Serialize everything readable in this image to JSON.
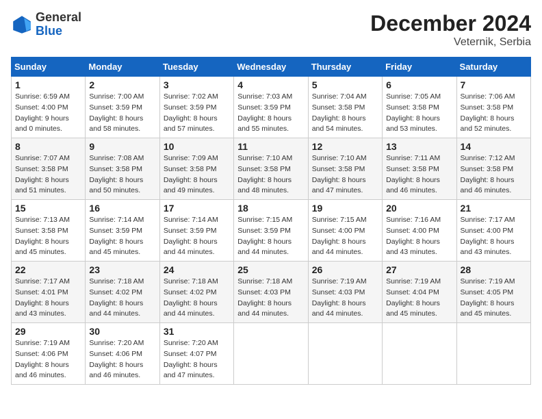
{
  "header": {
    "logo_general": "General",
    "logo_blue": "Blue",
    "month_title": "December 2024",
    "location": "Veternik, Serbia"
  },
  "weekdays": [
    "Sunday",
    "Monday",
    "Tuesday",
    "Wednesday",
    "Thursday",
    "Friday",
    "Saturday"
  ],
  "weeks": [
    [
      {
        "day": "1",
        "sunrise": "6:59 AM",
        "sunset": "4:00 PM",
        "daylight": "9 hours and 0 minutes."
      },
      {
        "day": "2",
        "sunrise": "7:00 AM",
        "sunset": "3:59 PM",
        "daylight": "8 hours and 58 minutes."
      },
      {
        "day": "3",
        "sunrise": "7:02 AM",
        "sunset": "3:59 PM",
        "daylight": "8 hours and 57 minutes."
      },
      {
        "day": "4",
        "sunrise": "7:03 AM",
        "sunset": "3:59 PM",
        "daylight": "8 hours and 55 minutes."
      },
      {
        "day": "5",
        "sunrise": "7:04 AM",
        "sunset": "3:58 PM",
        "daylight": "8 hours and 54 minutes."
      },
      {
        "day": "6",
        "sunrise": "7:05 AM",
        "sunset": "3:58 PM",
        "daylight": "8 hours and 53 minutes."
      },
      {
        "day": "7",
        "sunrise": "7:06 AM",
        "sunset": "3:58 PM",
        "daylight": "8 hours and 52 minutes."
      }
    ],
    [
      {
        "day": "8",
        "sunrise": "7:07 AM",
        "sunset": "3:58 PM",
        "daylight": "8 hours and 51 minutes."
      },
      {
        "day": "9",
        "sunrise": "7:08 AM",
        "sunset": "3:58 PM",
        "daylight": "8 hours and 50 minutes."
      },
      {
        "day": "10",
        "sunrise": "7:09 AM",
        "sunset": "3:58 PM",
        "daylight": "8 hours and 49 minutes."
      },
      {
        "day": "11",
        "sunrise": "7:10 AM",
        "sunset": "3:58 PM",
        "daylight": "8 hours and 48 minutes."
      },
      {
        "day": "12",
        "sunrise": "7:10 AM",
        "sunset": "3:58 PM",
        "daylight": "8 hours and 47 minutes."
      },
      {
        "day": "13",
        "sunrise": "7:11 AM",
        "sunset": "3:58 PM",
        "daylight": "8 hours and 46 minutes."
      },
      {
        "day": "14",
        "sunrise": "7:12 AM",
        "sunset": "3:58 PM",
        "daylight": "8 hours and 46 minutes."
      }
    ],
    [
      {
        "day": "15",
        "sunrise": "7:13 AM",
        "sunset": "3:58 PM",
        "daylight": "8 hours and 45 minutes."
      },
      {
        "day": "16",
        "sunrise": "7:14 AM",
        "sunset": "3:59 PM",
        "daylight": "8 hours and 45 minutes."
      },
      {
        "day": "17",
        "sunrise": "7:14 AM",
        "sunset": "3:59 PM",
        "daylight": "8 hours and 44 minutes."
      },
      {
        "day": "18",
        "sunrise": "7:15 AM",
        "sunset": "3:59 PM",
        "daylight": "8 hours and 44 minutes."
      },
      {
        "day": "19",
        "sunrise": "7:15 AM",
        "sunset": "4:00 PM",
        "daylight": "8 hours and 44 minutes."
      },
      {
        "day": "20",
        "sunrise": "7:16 AM",
        "sunset": "4:00 PM",
        "daylight": "8 hours and 43 minutes."
      },
      {
        "day": "21",
        "sunrise": "7:17 AM",
        "sunset": "4:00 PM",
        "daylight": "8 hours and 43 minutes."
      }
    ],
    [
      {
        "day": "22",
        "sunrise": "7:17 AM",
        "sunset": "4:01 PM",
        "daylight": "8 hours and 43 minutes."
      },
      {
        "day": "23",
        "sunrise": "7:18 AM",
        "sunset": "4:02 PM",
        "daylight": "8 hours and 44 minutes."
      },
      {
        "day": "24",
        "sunrise": "7:18 AM",
        "sunset": "4:02 PM",
        "daylight": "8 hours and 44 minutes."
      },
      {
        "day": "25",
        "sunrise": "7:18 AM",
        "sunset": "4:03 PM",
        "daylight": "8 hours and 44 minutes."
      },
      {
        "day": "26",
        "sunrise": "7:19 AM",
        "sunset": "4:03 PM",
        "daylight": "8 hours and 44 minutes."
      },
      {
        "day": "27",
        "sunrise": "7:19 AM",
        "sunset": "4:04 PM",
        "daylight": "8 hours and 45 minutes."
      },
      {
        "day": "28",
        "sunrise": "7:19 AM",
        "sunset": "4:05 PM",
        "daylight": "8 hours and 45 minutes."
      }
    ],
    [
      {
        "day": "29",
        "sunrise": "7:19 AM",
        "sunset": "4:06 PM",
        "daylight": "8 hours and 46 minutes."
      },
      {
        "day": "30",
        "sunrise": "7:20 AM",
        "sunset": "4:06 PM",
        "daylight": "8 hours and 46 minutes."
      },
      {
        "day": "31",
        "sunrise": "7:20 AM",
        "sunset": "4:07 PM",
        "daylight": "8 hours and 47 minutes."
      },
      null,
      null,
      null,
      null
    ]
  ]
}
